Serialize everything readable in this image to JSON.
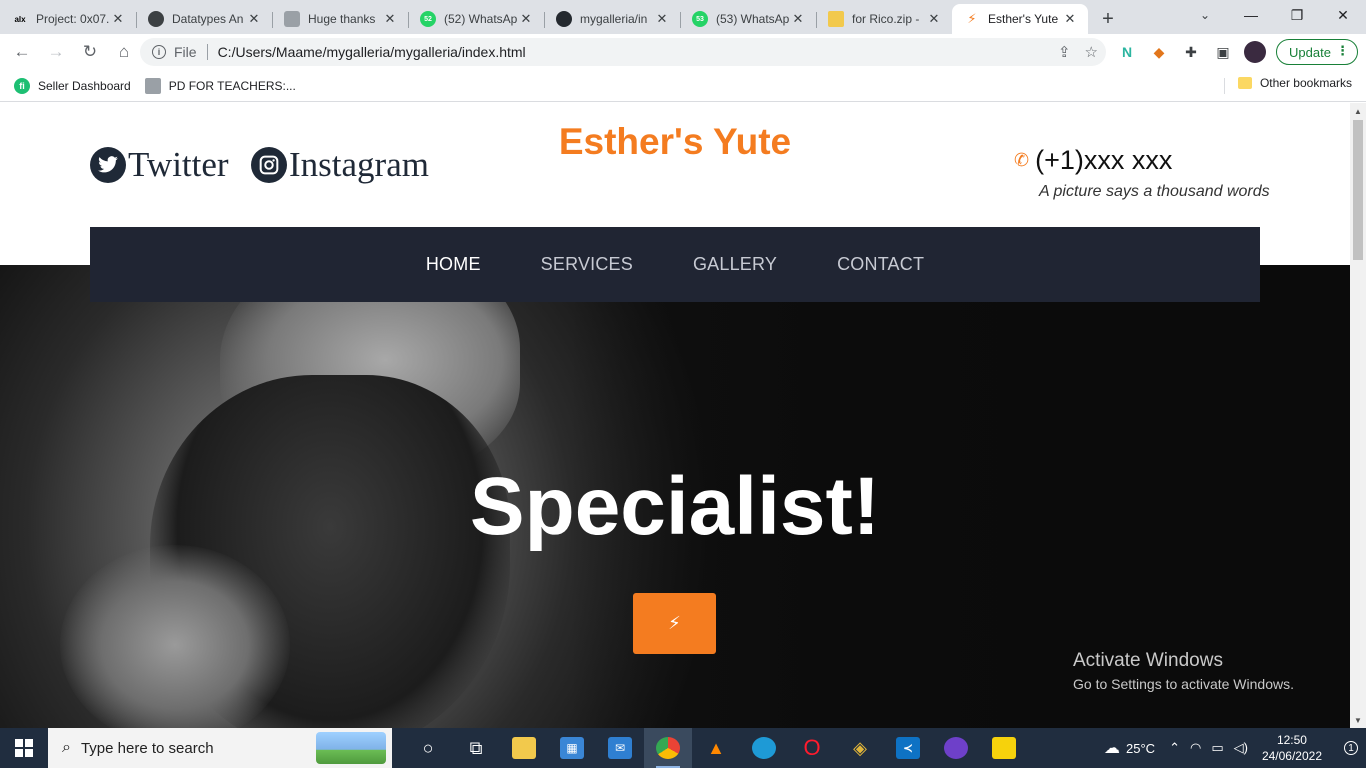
{
  "browser": {
    "tabs": [
      {
        "title": "Project: 0x07.",
        "favicon": "alx-icon",
        "fav_text": "alx",
        "fav_color": "#000000"
      },
      {
        "title": "Datatypes An",
        "favicon": "site-icon",
        "fav_text": "",
        "fav_color": "#3c4043"
      },
      {
        "title": "Huge thanks",
        "favicon": "database-icon",
        "fav_text": "",
        "fav_color": "#9aa0a6"
      },
      {
        "title": "(52) WhatsAp",
        "favicon": "whatsapp-icon",
        "fav_text": "52",
        "fav_color": "#25d366"
      },
      {
        "title": "mygalleria/in",
        "favicon": "github-icon",
        "fav_text": "",
        "fav_color": "#24292f"
      },
      {
        "title": "(53) WhatsAp",
        "favicon": "whatsapp-icon",
        "fav_text": "53",
        "fav_color": "#25d366"
      },
      {
        "title": "for Rico.zip -",
        "favicon": "zip-icon",
        "fav_text": "",
        "fav_color": "#f2c94c"
      },
      {
        "title": "Esther's Yute",
        "favicon": "bolt-icon",
        "fav_text": "",
        "fav_color": "#f47c20",
        "active": true
      }
    ],
    "new_tab": "+",
    "address": {
      "scheme_label": "File",
      "url": "C:/Users/Maame/mygalleria/mygalleria/index.html"
    },
    "update_label": "Update",
    "bookmarks": [
      {
        "label": "Seller Dashboard",
        "icon": "fiverr-icon"
      },
      {
        "label": "PD FOR TEACHERS:...",
        "icon": "doc-icon"
      }
    ],
    "other_bookmarks": "Other bookmarks"
  },
  "site": {
    "social": [
      {
        "label": "Twitter",
        "icon": "twitter-icon"
      },
      {
        "label": "Instagram",
        "icon": "instagram-icon"
      }
    ],
    "brand": "Esther's Yute",
    "phone": "(+1)xxx xxx",
    "tagline": "A picture says a thousand words",
    "nav": [
      {
        "label": "HOME",
        "active": true
      },
      {
        "label": "SERVICES"
      },
      {
        "label": "GALLERY"
      },
      {
        "label": "CONTACT"
      }
    ],
    "hero_title": "Specialist!",
    "hero_button_icon": "⚡",
    "accent": "#f47c20",
    "nav_bg": "#202533"
  },
  "watermark": {
    "line1": "Activate Windows",
    "line2": "Go to Settings to activate Windows."
  },
  "taskbar": {
    "search_placeholder": "Type here to search",
    "temperature": "25°C",
    "time": "12:50",
    "date": "24/06/2022",
    "notification_count": "1"
  }
}
